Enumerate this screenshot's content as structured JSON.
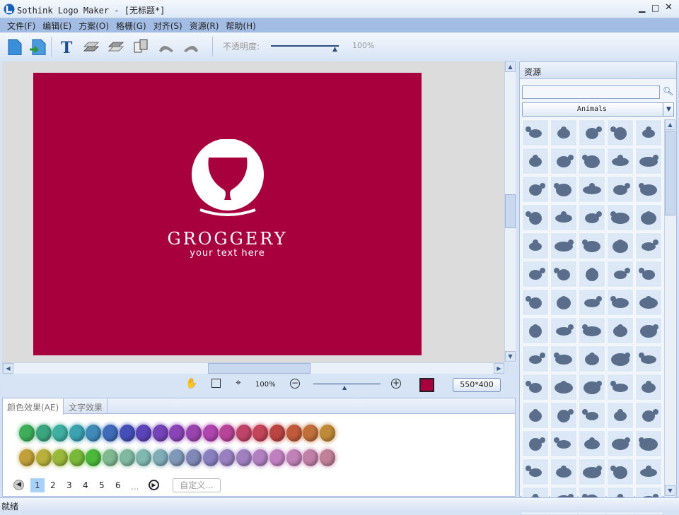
{
  "title": "Sothink Logo Maker - [无标题*]",
  "menu": [
    "文件(F)",
    "编辑(E)",
    "方案(O)",
    "格栅(G)",
    "对齐(S)",
    "资源(R)",
    "帮助(H)"
  ],
  "toolbar": {
    "opacity_label": "不透明度:",
    "opacity_value": "100%",
    "opacity_fraction": 1.0
  },
  "logo": {
    "name": "GROGGERY",
    "tagline": "your text here",
    "background": "#a8003c"
  },
  "zoom": {
    "value": "100%",
    "canvas_size": "550*400",
    "fill_color": "#a8003c"
  },
  "tabs": [
    "颜色效果(AE)",
    "文字效果"
  ],
  "swatches": [
    [
      "#3fae5a",
      "#3aa67f",
      "#3fb0a0",
      "#3aa2b0",
      "#3f8ab8",
      "#3f6cb8",
      "#4450b8",
      "#5a44b8",
      "#7444b8",
      "#8a44b8",
      "#9a44b0",
      "#b044b0",
      "#b8449a",
      "#c0446a",
      "#c44458",
      "#bc4440",
      "#c05a3a",
      "#c0703a",
      "#c08a3a"
    ],
    [
      "#c0a03a",
      "#b8b03a",
      "#9ab83a",
      "#7ab83a",
      "#4ab83a",
      "#80b890",
      "#80b8a0",
      "#80b8b0",
      "#80acb8",
      "#8098b8",
      "#8088b8",
      "#8880c0",
      "#9880c0",
      "#a080c0",
      "#b080c0",
      "#c080c0",
      "#c080b8",
      "#c080a8",
      "#c08098"
    ]
  ],
  "pagination": {
    "pages": [
      "1",
      "2",
      "3",
      "4",
      "5",
      "6"
    ],
    "ellipsis": "...",
    "current": "1",
    "custom_button": "自定义..."
  },
  "resources": {
    "title": "资源",
    "search_value": "",
    "category": "Animals"
  },
  "status": "就绪"
}
